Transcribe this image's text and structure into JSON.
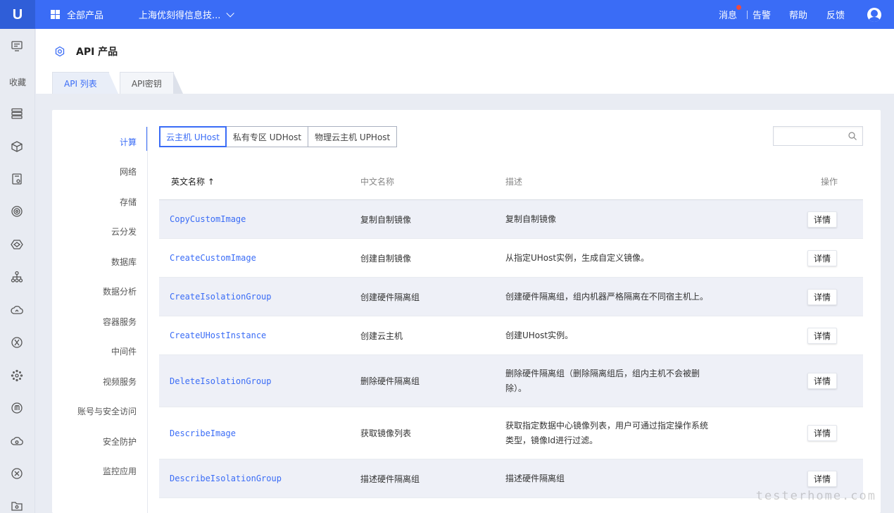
{
  "topbar": {
    "logo": "U",
    "all_products": "全部产品",
    "company": "上海优刻得信息技...",
    "messages": "消息",
    "alarm": "告警",
    "help": "帮助",
    "feedback": "反馈"
  },
  "sidebar": {
    "favorites_label": "收藏",
    "icons": [
      "monitor-icon",
      "server-stack-icon",
      "box-icon",
      "storage-icon",
      "target-icon",
      "network-icon",
      "hierarchy-icon",
      "cloud-icon",
      "middleware-icon",
      "cluster-icon",
      "security-icon",
      "cloud-sync-icon",
      "shield-icon",
      "folder-icon"
    ]
  },
  "page": {
    "title": "API 产品",
    "tabs": [
      {
        "label": "API 列表",
        "active": true
      },
      {
        "label": "API密钥",
        "active": false
      }
    ]
  },
  "categories": [
    {
      "label": "计算",
      "active": true
    },
    {
      "label": "网络",
      "active": false
    },
    {
      "label": "存储",
      "active": false
    },
    {
      "label": "云分发",
      "active": false
    },
    {
      "label": "数据库",
      "active": false
    },
    {
      "label": "数据分析",
      "active": false
    },
    {
      "label": "容器服务",
      "active": false
    },
    {
      "label": "中间件",
      "active": false
    },
    {
      "label": "视频服务",
      "active": false
    },
    {
      "label": "账号与安全访问",
      "active": false
    },
    {
      "label": "安全防护",
      "active": false
    },
    {
      "label": "监控应用",
      "active": false
    }
  ],
  "filters": [
    {
      "label": "云主机 UHost",
      "active": true
    },
    {
      "label": "私有专区 UDHost",
      "active": false
    },
    {
      "label": "物理云主机 UPHost",
      "active": false
    }
  ],
  "search": {
    "placeholder": "",
    "value": ""
  },
  "table": {
    "headers": {
      "en_name": "英文名称 ↑",
      "cn_name": "中文名称",
      "desc": "描述",
      "action": "操作"
    },
    "rows": [
      {
        "en": "CopyCustomImage",
        "cn": "复制自制镜像",
        "desc": "复制自制镜像",
        "btn": "详情",
        "h": 55
      },
      {
        "en": "CreateCustomImage",
        "cn": "创建自制镜像",
        "desc": "从指定UHost实例，生成自定义镜像。",
        "btn": "详情",
        "h": 55
      },
      {
        "en": "CreateIsolationGroup",
        "cn": "创建硬件隔离组",
        "desc": "创建硬件隔离组，组内机器严格隔离在不同宿主机上。",
        "btn": "详情",
        "h": 55
      },
      {
        "en": "CreateUHostInstance",
        "cn": "创建云主机",
        "desc": "创建UHost实例。",
        "btn": "详情",
        "h": 55
      },
      {
        "en": "DeleteIsolationGroup",
        "cn": "删除硬件隔离组",
        "desc": "删除硬件隔离组（删除隔离组后，组内主机不会被删除）。",
        "btn": "详情",
        "h": 74
      },
      {
        "en": "DescribeImage",
        "cn": "获取镜像列表",
        "desc": "获取指定数据中心镜像列表，用户可通过指定操作系统类型，镜像Id进行过滤。",
        "btn": "详情",
        "h": 74
      },
      {
        "en": "DescribeIsolationGroup",
        "cn": "描述硬件隔离组",
        "desc": "描述硬件隔离组",
        "btn": "详情",
        "h": 55
      }
    ]
  },
  "watermark": "testerhome.com"
}
